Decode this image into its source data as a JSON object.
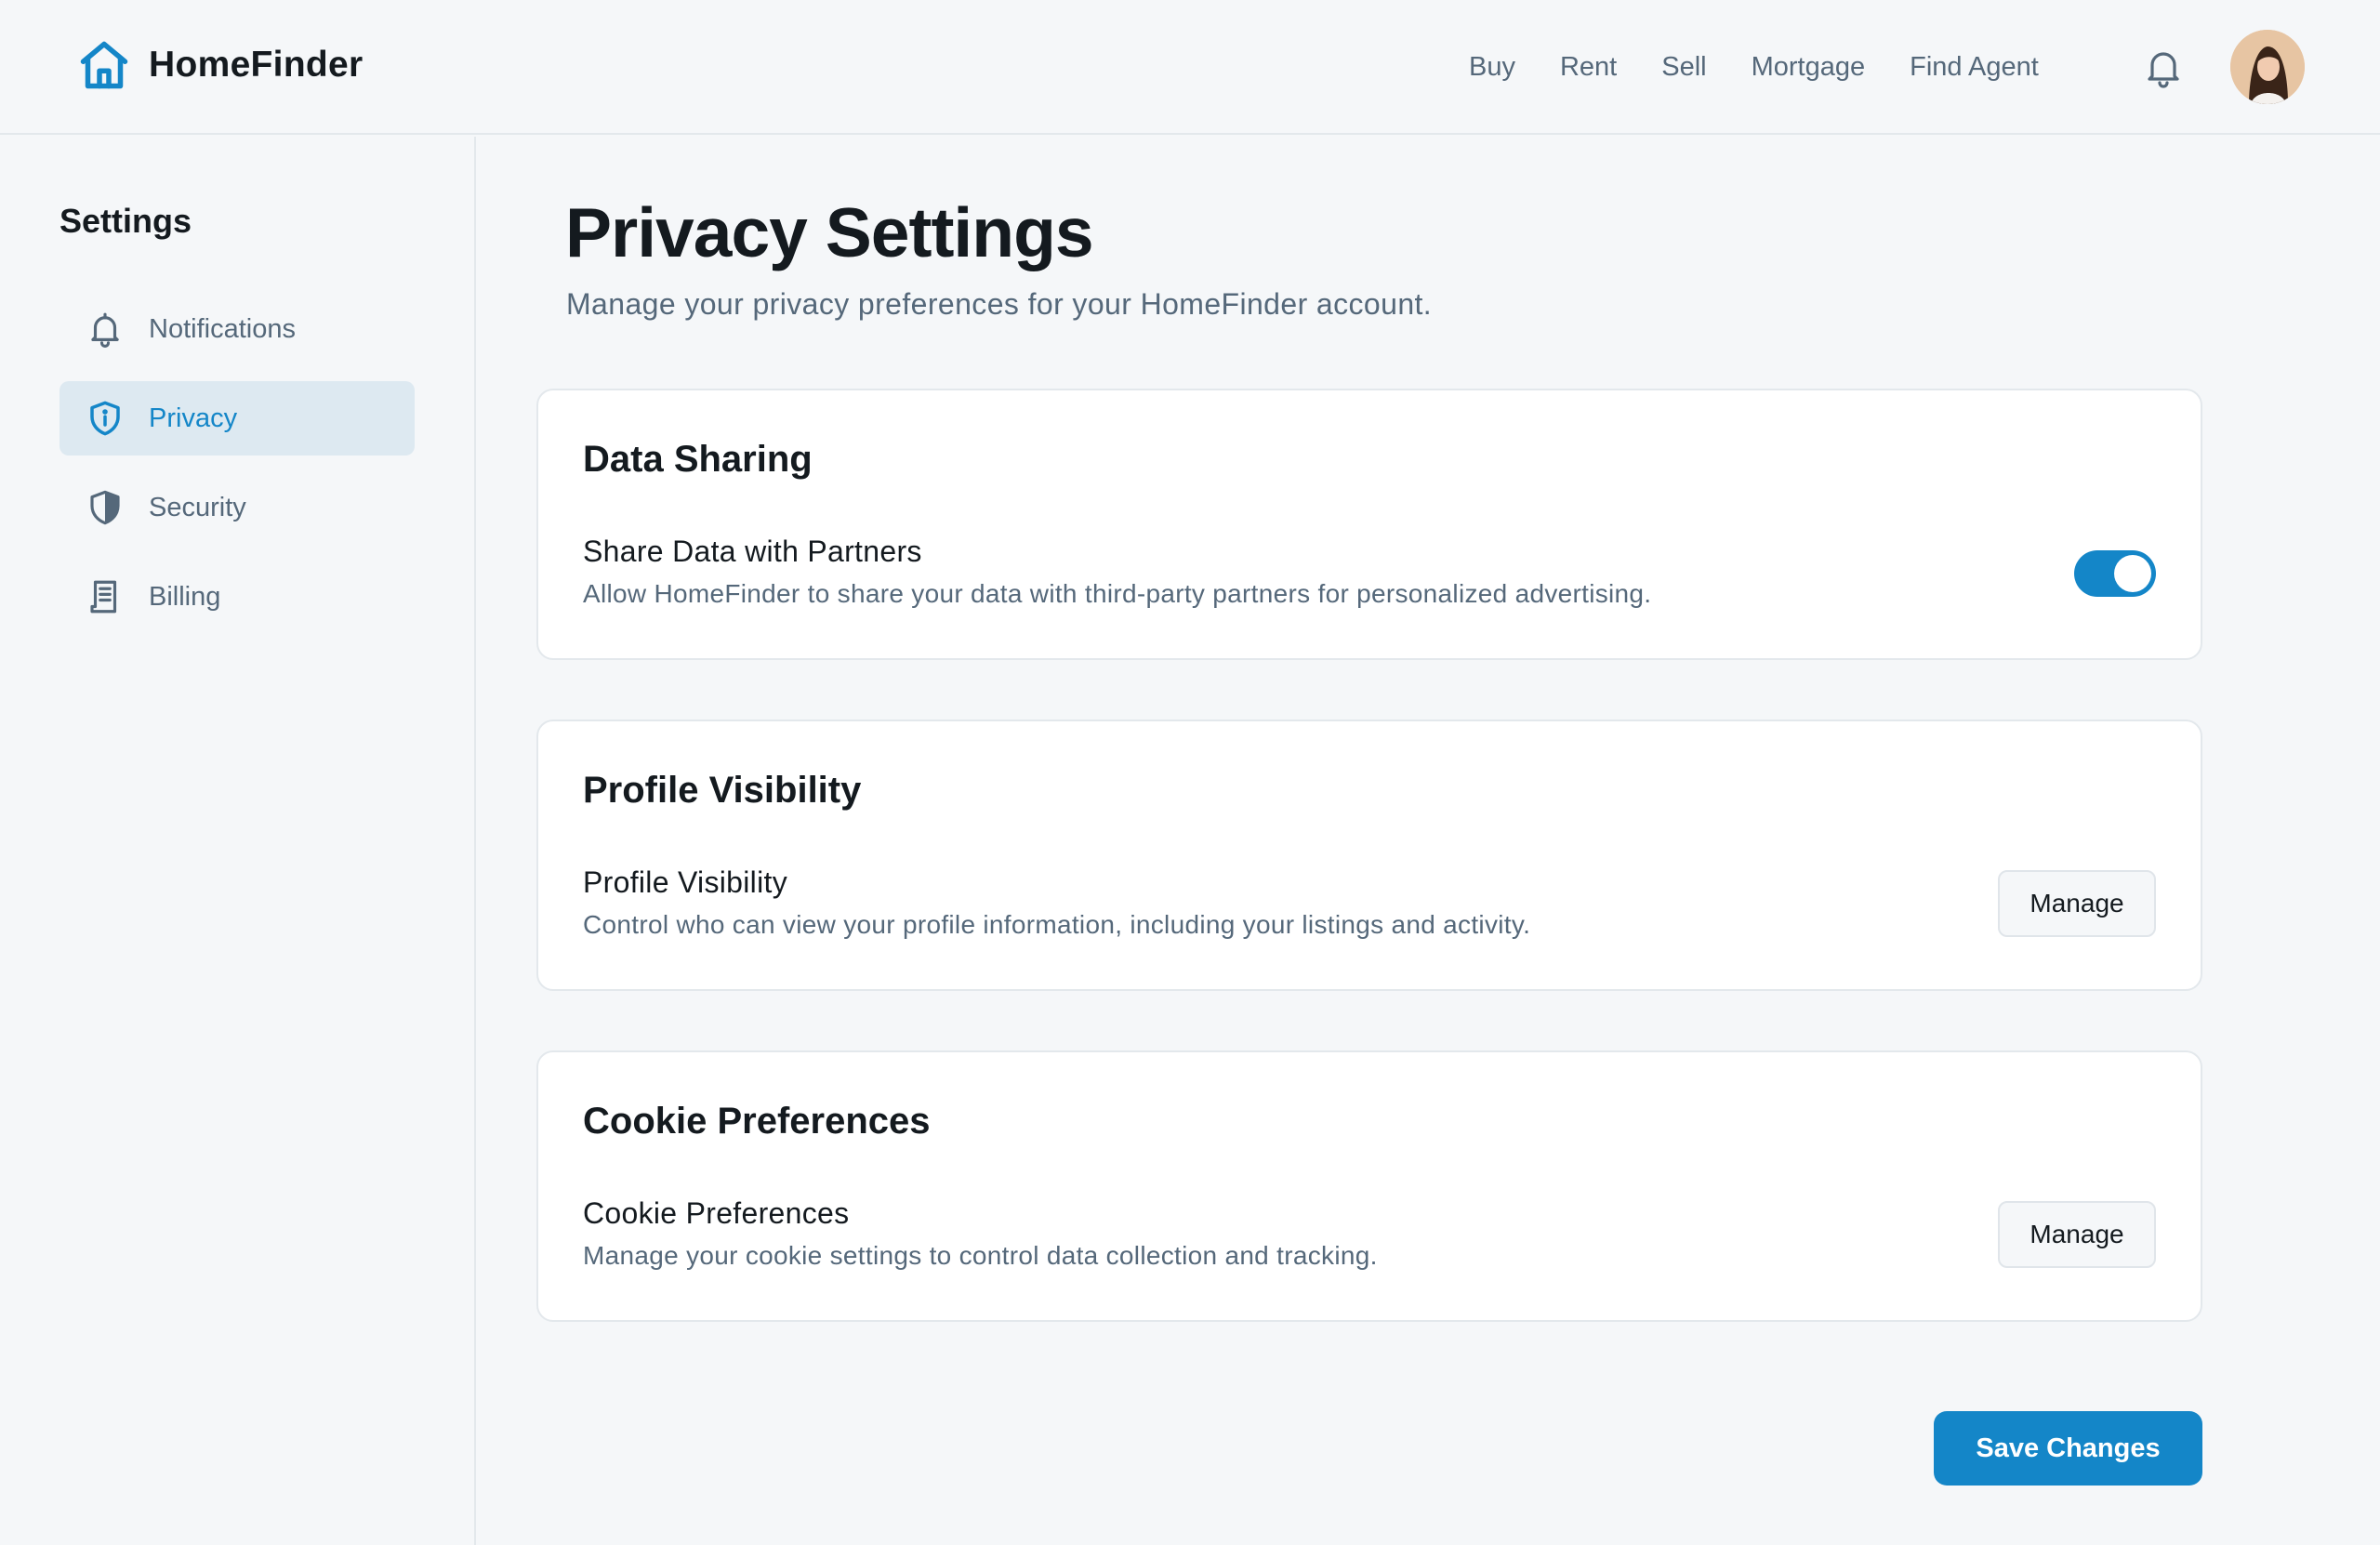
{
  "brand": {
    "name": "HomeFinder",
    "icon": "home-icon",
    "accent_color": "#1486c8"
  },
  "topnav": {
    "items": [
      {
        "label": "Buy"
      },
      {
        "label": "Rent"
      },
      {
        "label": "Sell"
      },
      {
        "label": "Mortgage"
      },
      {
        "label": "Find Agent"
      }
    ],
    "notification_icon": "bell-icon",
    "avatar_icon": "user-avatar"
  },
  "sidebar": {
    "title": "Settings",
    "items": [
      {
        "label": "Notifications",
        "icon": "bell-icon",
        "active": false
      },
      {
        "label": "Privacy",
        "icon": "shield-info-icon",
        "active": true
      },
      {
        "label": "Security",
        "icon": "shield-icon",
        "active": false
      },
      {
        "label": "Billing",
        "icon": "receipt-icon",
        "active": false
      }
    ]
  },
  "main": {
    "title": "Privacy Settings",
    "subtitle": "Manage your privacy preferences for your HomeFinder account.",
    "cards": [
      {
        "title": "Data Sharing",
        "label": "Share Data with Partners",
        "description": "Allow HomeFinder to share your data with third-party partners for personalized advertising.",
        "control": "toggle",
        "toggle_on": true
      },
      {
        "title": "Profile Visibility",
        "label": "Profile Visibility",
        "description": "Control who can view your profile information, including your listings and activity.",
        "control": "button",
        "button_label": "Manage"
      },
      {
        "title": "Cookie Preferences",
        "label": "Cookie Preferences",
        "description": "Manage your cookie settings to control data collection and tracking.",
        "control": "button",
        "button_label": "Manage"
      }
    ],
    "save_label": "Save Changes"
  }
}
